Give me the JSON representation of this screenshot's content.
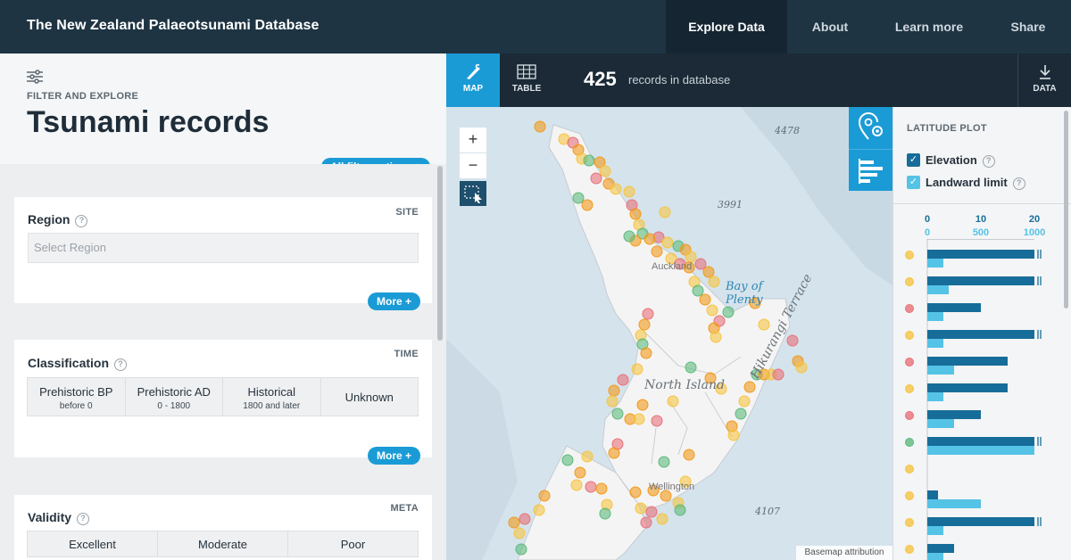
{
  "header": {
    "title": "The New Zealand Palaeotsunami Database",
    "nav": [
      "Explore Data",
      "About",
      "Learn more",
      "Share"
    ]
  },
  "filter_panel": {
    "kicker": "FILTER AND EXPLORE",
    "title": "Tsunami records",
    "all_filters_label": "All filter options +",
    "region": {
      "label": "Region",
      "tag": "SITE",
      "placeholder": "Select Region",
      "more_label": "More +"
    },
    "classification": {
      "label": "Classification",
      "tag": "TIME",
      "options": [
        {
          "main": "Prehistoric BP",
          "sub": "before 0"
        },
        {
          "main": "Prehistoric AD",
          "sub": "0 - 1800"
        },
        {
          "main": "Historical",
          "sub": "1800 and later"
        },
        {
          "main": "Unknown",
          "sub": ""
        }
      ],
      "more_label": "More +"
    },
    "validity": {
      "label": "Validity",
      "tag": "META",
      "options": [
        "Excellent",
        "Moderate",
        "Poor"
      ]
    }
  },
  "map_toolbar": {
    "tabs": [
      {
        "label": "MAP",
        "icon": "map-pen-icon"
      },
      {
        "label": "TABLE",
        "icon": "table-grid-icon"
      }
    ],
    "record_count": "425",
    "record_label": "records in database",
    "data_label": "DATA"
  },
  "map": {
    "zoom_in": "+",
    "zoom_out": "−",
    "attribution": "Basemap attribution",
    "labels": {
      "depth_1": "4478",
      "depth_2": "3991",
      "depth_3": "4107",
      "bay": "Bay of Plenty",
      "island": "North Island",
      "terrace": "Hikurangi Terrace",
      "auckland": "Auckland",
      "wellington": "Wellington"
    },
    "colors": {
      "ocean": "#d5e3ec",
      "land": "#f4f4f4",
      "orange": "#f29a1a",
      "yellow": "#f6c443",
      "red": "#e8727a",
      "green": "#5dba7d"
    }
  },
  "latitude_plot": {
    "title": "LATITUDE PLOT",
    "toggles": [
      {
        "label": "Elevation",
        "checked": true,
        "color": "#176d99"
      },
      {
        "label": "Landward limit",
        "checked": true,
        "color": "#55c3e6"
      }
    ],
    "elevation_axis": [
      "0",
      "10",
      "20"
    ],
    "landward_axis": [
      "0",
      "500",
      "1000"
    ],
    "chart_data": {
      "type": "bar",
      "series": [
        {
          "name": "Elevation",
          "values": [
            20,
            20,
            10,
            20,
            15,
            15,
            10,
            20,
            0,
            2,
            20,
            5
          ],
          "max": 20
        },
        {
          "name": "Landward limit",
          "values": [
            150,
            200,
            150,
            150,
            250,
            150,
            250,
            1000,
            0,
            500,
            150,
            150
          ],
          "max": 1000
        }
      ],
      "point_colors": [
        "#f6c443",
        "#f6c443",
        "#e8727a",
        "#f6c443",
        "#e8727a",
        "#f6c443",
        "#e8727a",
        "#5dba7d",
        "#f6c443",
        "#f6c443",
        "#f6c443",
        "#f6c443"
      ]
    }
  }
}
